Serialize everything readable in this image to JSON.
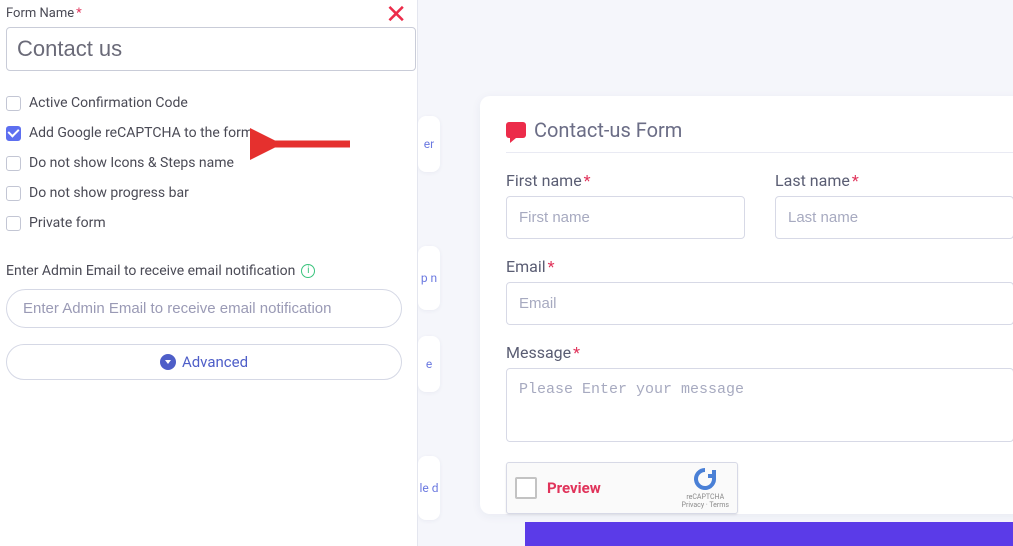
{
  "panel": {
    "form_name_label": "Form Name",
    "form_name_value": "Contact us",
    "checkboxes": {
      "active_confirmation": {
        "label": "Active Confirmation Code",
        "checked": false
      },
      "recaptcha": {
        "label": "Add Google reCAPTCHA to the form",
        "checked": true
      },
      "hide_icons_steps": {
        "label": "Do not show Icons & Steps name",
        "checked": false
      },
      "hide_progress": {
        "label": "Do not show progress bar",
        "checked": false
      },
      "private_form": {
        "label": "Private form",
        "checked": false
      }
    },
    "admin_email_label": "Enter Admin Email to receive email notification",
    "admin_email_placeholder": "Enter Admin Email to receive email notification",
    "advanced_label": "Advanced"
  },
  "preview": {
    "title": "Contact-us Form",
    "fields": {
      "first_name": {
        "label": "First name",
        "placeholder": "First name"
      },
      "last_name": {
        "label": "Last name",
        "placeholder": "Last name"
      },
      "email": {
        "label": "Email",
        "placeholder": "Email"
      },
      "message": {
        "label": "Message",
        "placeholder": "Please Enter your message"
      }
    },
    "recaptcha": {
      "label": "Preview",
      "brand": "reCAPTCHA",
      "legal": "Privacy · Terms"
    }
  },
  "peek_texts": {
    "a": "er",
    "b": "p\nn",
    "c": "e",
    "d": "le\nd"
  }
}
